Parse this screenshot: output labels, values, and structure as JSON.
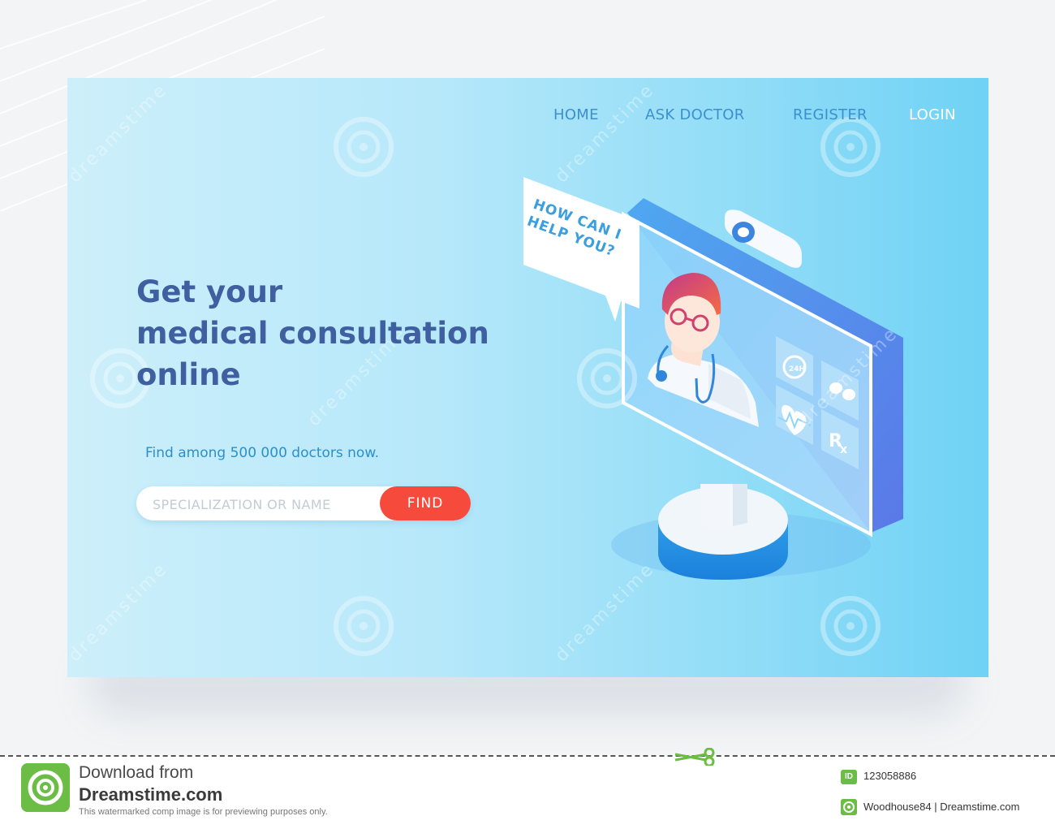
{
  "nav": {
    "home": "HOME",
    "ask_doctor": "ASK DOCTOR",
    "register": "REGISTER",
    "login": "LOGIN"
  },
  "hero": {
    "headline": [
      "Get your",
      "medical consultation",
      "online"
    ],
    "subtext": "Find among 500 000 doctors now.",
    "search_placeholder": "SPECIALIZATION OR NAME",
    "find_button": "FIND"
  },
  "illustration": {
    "speech_bubble": [
      "HOW CAN I",
      "HELP YOU?"
    ],
    "tiles": [
      "24H",
      "pills",
      "heart-rate",
      "Rx"
    ],
    "icons": [
      "doctor-icon",
      "webcam-icon",
      "clock-24h-icon",
      "pills-icon",
      "heart-rate-icon",
      "prescription-icon"
    ]
  },
  "watermark": {
    "text": "dreamstime"
  },
  "footer": {
    "line1": "Download from",
    "line2": "Dreamstime.com",
    "line3": "This watermarked comp image is for previewing purposes only.",
    "id_label": "ID",
    "id": "123058886",
    "credit": "Woodhouse84 | Dreamstime.com"
  },
  "colors": {
    "accent": "#f64a3c",
    "headline": "#3f5fa0",
    "nav": "#3c8fd0",
    "brand_green": "#6cbd45"
  }
}
